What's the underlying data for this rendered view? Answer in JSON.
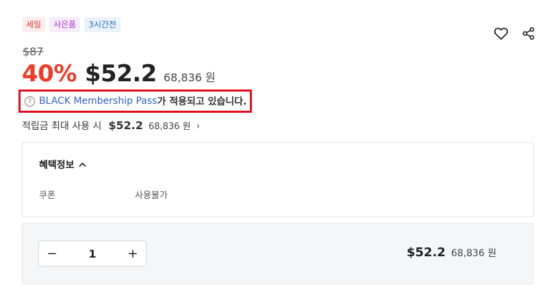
{
  "badges": {
    "sale": "세일",
    "gift": "사은품",
    "delivery": "3시간전"
  },
  "price": {
    "original": "$87",
    "discount": "40%",
    "sale": "$52.2",
    "won": "68,836 원"
  },
  "membership": {
    "help_glyph": "?",
    "link_text": "BLACK Membership Pass",
    "suffix": "가 적용되고 있습니다."
  },
  "points": {
    "label": "적립금 최대 사용 시",
    "amount": "$52.2",
    "won": "68,836 원",
    "chevron": "›"
  },
  "benefits": {
    "title": "혜택정보",
    "toggle_glyph": "^",
    "coupon_label": "쿠폰",
    "coupon_value": "사용불가"
  },
  "order": {
    "minus": "−",
    "quantity": "1",
    "plus": "+",
    "total_price": "$52.2",
    "total_won": "68,836 원"
  },
  "icons": {
    "wishlist": "heart-icon",
    "share": "share-icon"
  },
  "colors": {
    "discount": "#f03a24",
    "membership_link": "#2d62c9",
    "highlight_border": "#e30b1b"
  }
}
